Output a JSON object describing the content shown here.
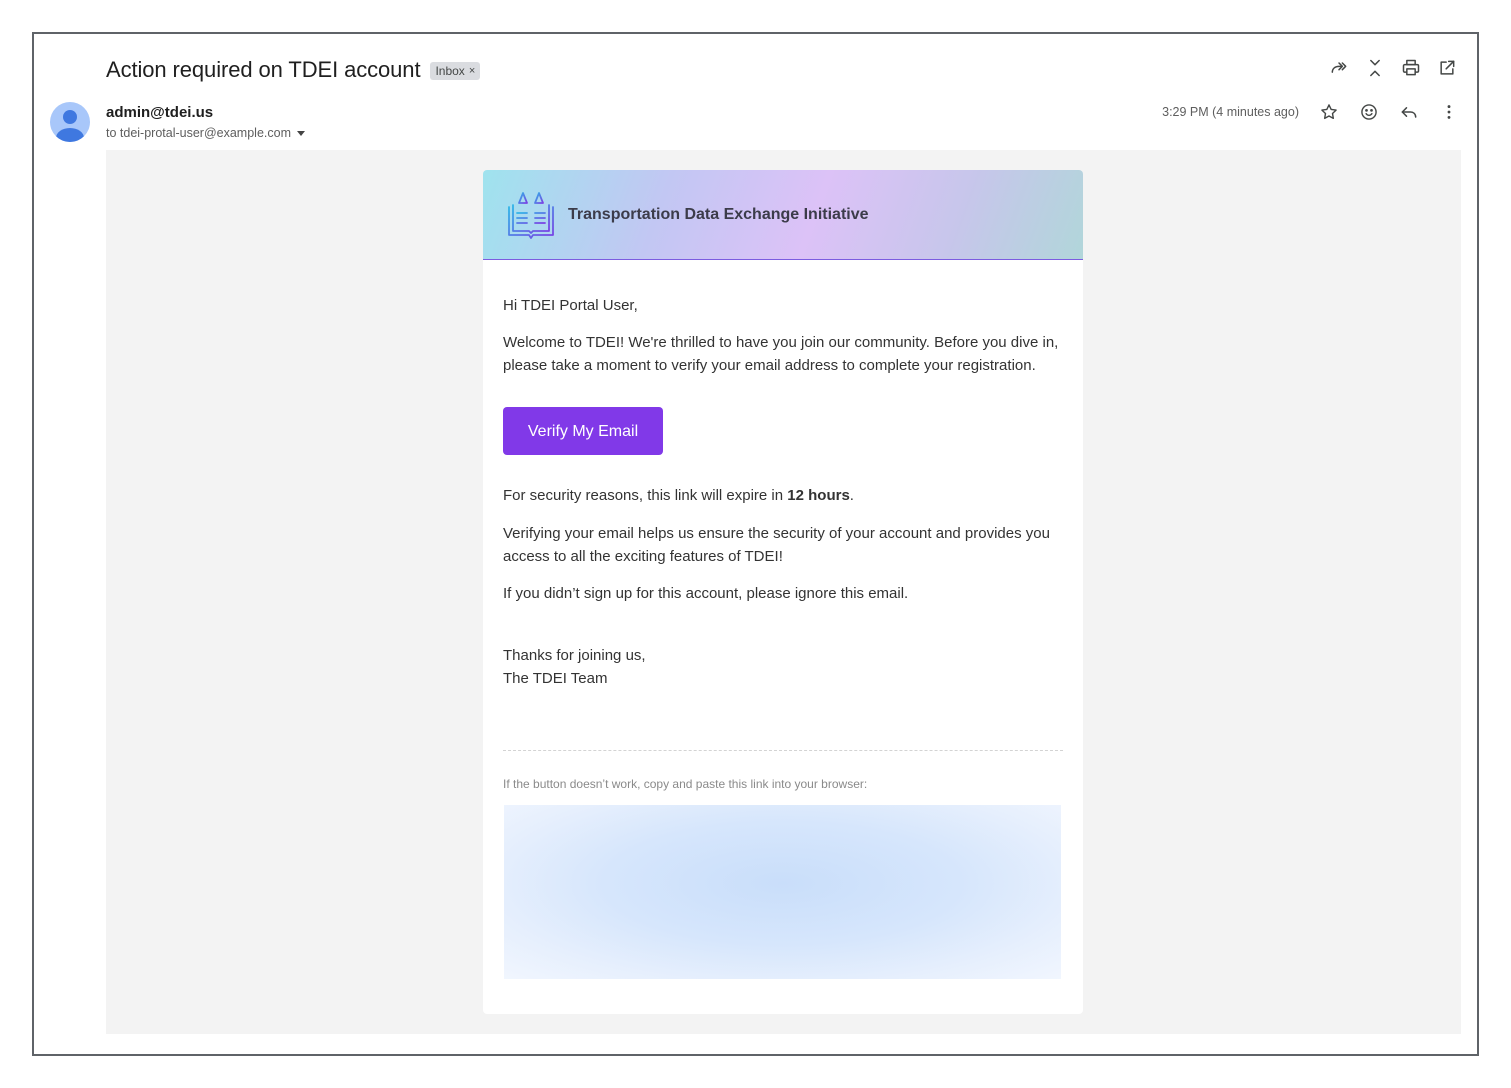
{
  "email": {
    "subject": "Action required on TDEI account",
    "label": "Inbox",
    "label_remove": "×",
    "sender": "admin@tdei.us",
    "recipient": "to tdei-protal-user@example.com",
    "timestamp": "3:29 PM (4 minutes ago)"
  },
  "icons": {
    "top_actions": [
      "forward-all-icon",
      "collapse-icon",
      "print-icon",
      "open-new-window-icon"
    ],
    "meta_actions": [
      "star-icon",
      "emoji-icon",
      "reply-icon",
      "more-vert-icon"
    ]
  },
  "message": {
    "org_name": "Transportation Data Exchange Initiative",
    "greeting": "Hi TDEI Portal User,",
    "welcome": "Welcome to TDEI! We're thrilled to have you join our community. Before you dive in, please take a moment to verify your email address to complete your registration.",
    "button_label": "Verify My Email",
    "expiry_prefix": "For security reasons, this link will expire in ",
    "expiry_value": "12 hours",
    "expiry_suffix": ".",
    "benefit": "Verifying your email helps us ensure the security of your account and provides you access to all the exciting features of TDEI!",
    "ignore_note": "If you didn’t sign up for this account, please ignore this email.",
    "signoff_line1": "Thanks for joining us,",
    "signoff_line2": "The TDEI Team",
    "fallback_note": "If the button doesn’t work, copy and paste this link into your browser:"
  },
  "colors": {
    "button": "#8139e8",
    "avatar": "#a8c7fa",
    "body_background": "#f3f3f3"
  }
}
